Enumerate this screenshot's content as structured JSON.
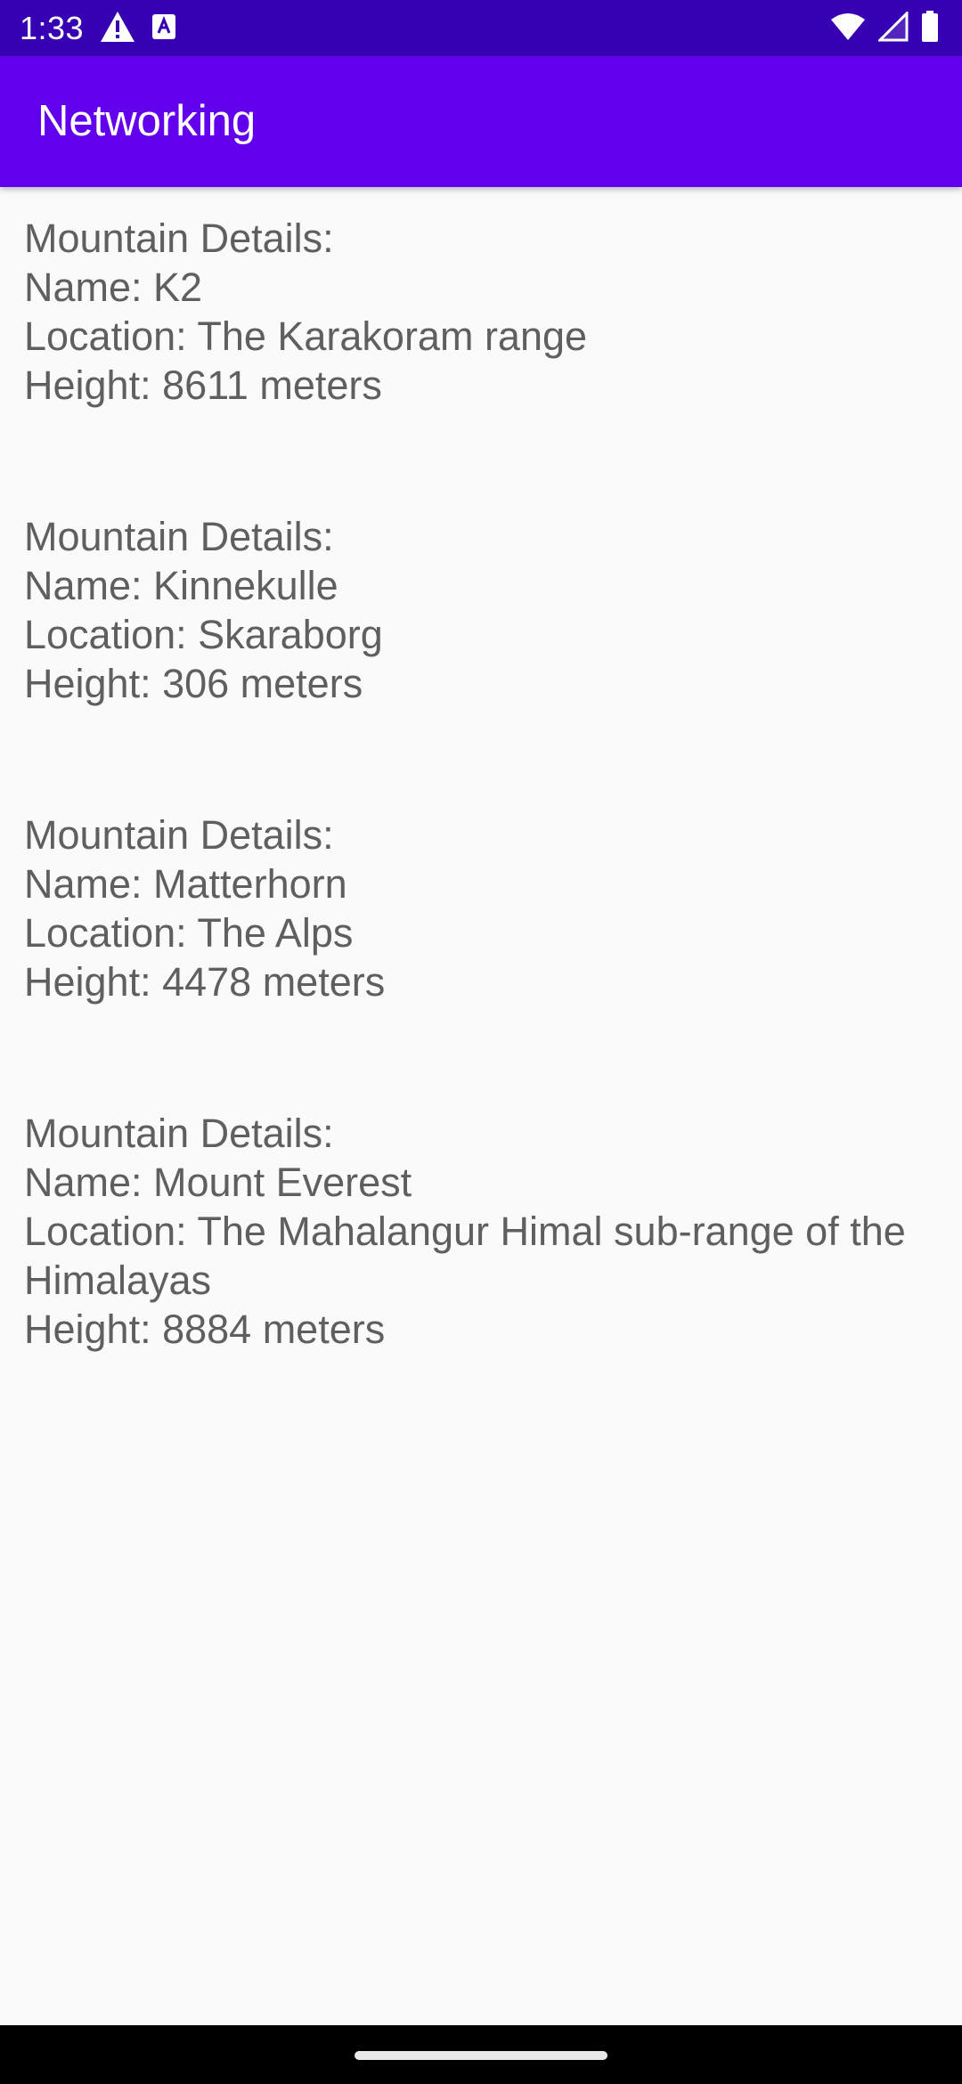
{
  "status_bar": {
    "time": "1:33",
    "left_icons": [
      "warning-icon",
      "keyboard-a-icon"
    ],
    "right_icons": [
      "wifi-icon",
      "cell-signal-icon",
      "battery-icon"
    ]
  },
  "app_bar": {
    "title": "Networking"
  },
  "mountains": [
    {
      "header": "Mountain Details:",
      "name": "Name: K2",
      "location": "Location: The Karakoram range",
      "height": "Height: 8611 meters"
    },
    {
      "header": "Mountain Details:",
      "name": "Name: Kinnekulle",
      "location": "Location: Skaraborg",
      "height": "Height: 306 meters"
    },
    {
      "header": "Mountain Details:",
      "name": "Name: Matterhorn",
      "location": "Location: The Alps",
      "height": "Height: 4478 meters"
    },
    {
      "header": "Mountain Details:",
      "name": "Name: Mount Everest",
      "location": "Location: The Mahalangur Himal sub-range of the Himalayas",
      "height": "Height: 8884 meters"
    }
  ],
  "colors": {
    "status_bar": "#3700b3",
    "app_bar": "#6200ee",
    "background": "#fafafa",
    "item_text": "#5f5f5f"
  }
}
